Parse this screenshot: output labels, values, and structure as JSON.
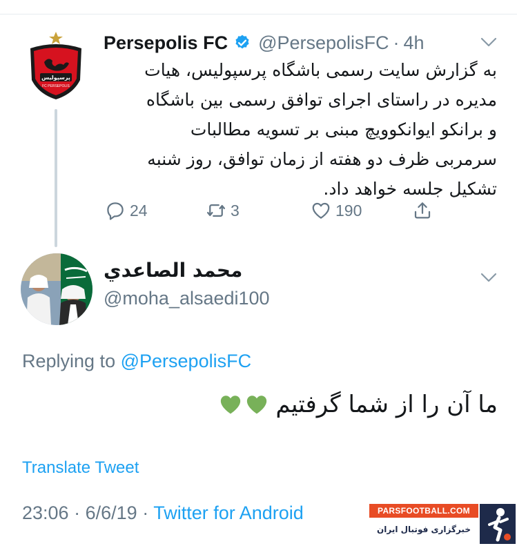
{
  "parent_tweet": {
    "name": "Persepolis FC",
    "handle": "@PersepolisFC",
    "separator": "·",
    "time": "4h",
    "text_lines": [
      "به گزارش سایت رسمی باشگاه پرسپولیس، هیات",
      "مدیره در راستای اجرای توافق رسمی بین باشگاه",
      "و برانکو ایوانکوویچ مبنی بر تسویه مطالبات",
      "سرمربی  ظرف دو هفته از زمان توافق، روز شنبه",
      "تشکیل جلسه خواهد داد."
    ],
    "replies_count": "24",
    "retweets_count": "3",
    "likes_count": "190",
    "avatar": {
      "icon": "persepolis-logo-icon",
      "logo_text": "پرسپولیس",
      "logo_caption": "FC PERSEPOLIS",
      "colors": {
        "primary": "#d6121f",
        "dark": "#1a1a1a",
        "gold": "#c9a23a"
      }
    }
  },
  "reply_tweet": {
    "name": "محمد الصاعدي",
    "handle": "@moha_alsaedi100",
    "replying_prefix": "Replying to",
    "replying_mention": "@PersepolisFC",
    "text": "ما آن را از شما گرفتیم",
    "emoji": [
      "green-heart",
      "green-heart"
    ],
    "translate_label": "Translate Tweet",
    "time": "23:06",
    "date": "6/6/19",
    "separator": "·",
    "source": "Twitter for Android"
  },
  "watermark": {
    "site": "PARSFOOTBALL.COM",
    "tagline": "خبرگزاری فوتبال ایران"
  },
  "colors": {
    "link_blue": "#1da1f2",
    "muted": "#657786",
    "text": "#14171a",
    "heart_green": "#78b159",
    "watermark_orange": "#e84c25"
  }
}
